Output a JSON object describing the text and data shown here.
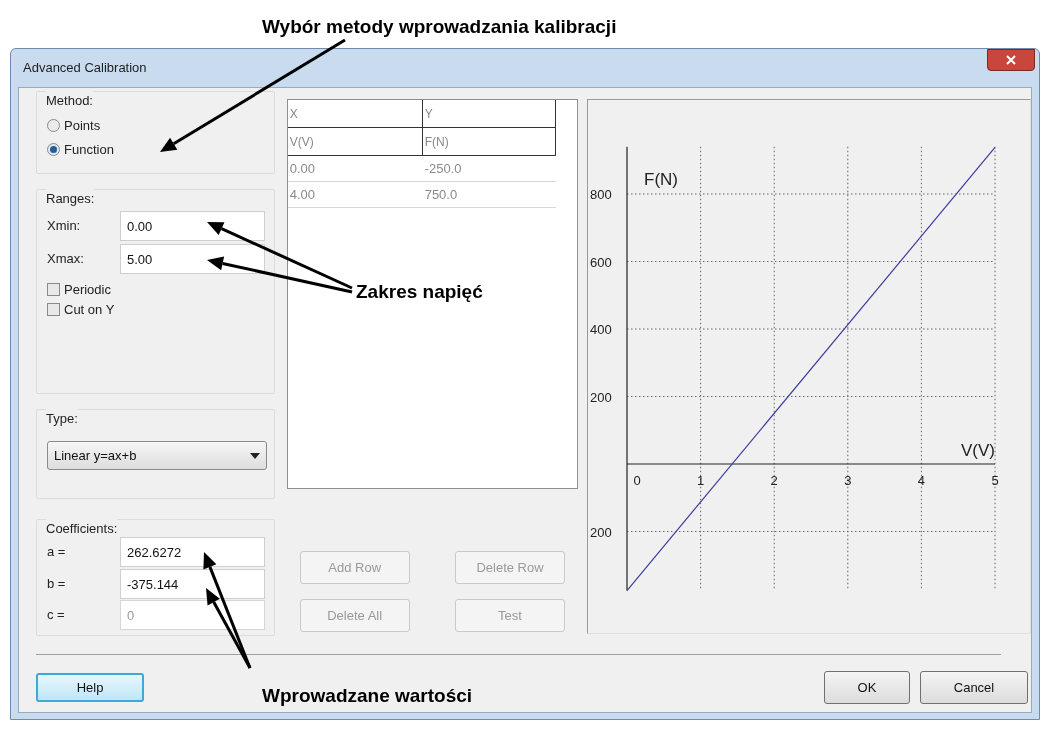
{
  "annotations": [
    {
      "text": "Wybór metody wprowadzania kalibracji"
    },
    {
      "text": "Zakres napięć"
    },
    {
      "text": "Wprowadzane wartości"
    }
  ],
  "window": {
    "title": "Advanced Calibration"
  },
  "method": {
    "label": "Method:",
    "options": [
      {
        "label": "Points",
        "selected": false
      },
      {
        "label": "Function",
        "selected": true
      }
    ]
  },
  "ranges": {
    "label": "Ranges:",
    "fields": [
      {
        "label": "Xmin:",
        "value": "0.00"
      },
      {
        "label": "Xmax:",
        "value": "5.00"
      }
    ],
    "checkboxes": [
      {
        "label": "Periodic",
        "checked": false
      },
      {
        "label": "Cut on Y",
        "checked": false
      }
    ]
  },
  "type": {
    "label": "Type:",
    "value": "Linear y=ax+b"
  },
  "coefficients": {
    "label": "Coefficients:",
    "fields": [
      {
        "label": "a =",
        "value": "262.6272",
        "disabled": false
      },
      {
        "label": "b =",
        "value": "-375.144",
        "disabled": false
      },
      {
        "label": "c =",
        "value": "0",
        "disabled": true
      }
    ]
  },
  "table": {
    "header_rows": [
      [
        "X",
        "Y"
      ],
      [
        "V(V)",
        "F(N)"
      ]
    ],
    "rows": [
      [
        "0.00",
        "-250.0"
      ],
      [
        "4.00",
        "750.0"
      ]
    ]
  },
  "table_buttons": [
    {
      "label": "Add Row",
      "disabled": true
    },
    {
      "label": "Delete Row",
      "disabled": true
    },
    {
      "label": "Delete All",
      "disabled": true
    },
    {
      "label": "Test",
      "disabled": true
    }
  ],
  "chart": {
    "chart_data": {
      "type": "line",
      "xlabel": "V(V)",
      "ylabel": "F(N)",
      "x": [
        0,
        5
      ],
      "series": [
        {
          "color": "#3c3ca0",
          "values": [
            -375,
            938
          ]
        }
      ],
      "grid": true,
      "xlim": [
        0,
        5
      ],
      "ylim": [
        -375,
        940
      ],
      "xticks": [
        0,
        1,
        2,
        3,
        4,
        5
      ],
      "yticks": [
        800,
        600,
        400,
        200,
        {
          "value": -200,
          "label": "200"
        }
      ]
    }
  },
  "buttons": [
    {
      "label": "Help",
      "kind": "help"
    },
    {
      "label": "OK",
      "kind": "normal"
    },
    {
      "label": "Cancel",
      "kind": "normal"
    }
  ]
}
